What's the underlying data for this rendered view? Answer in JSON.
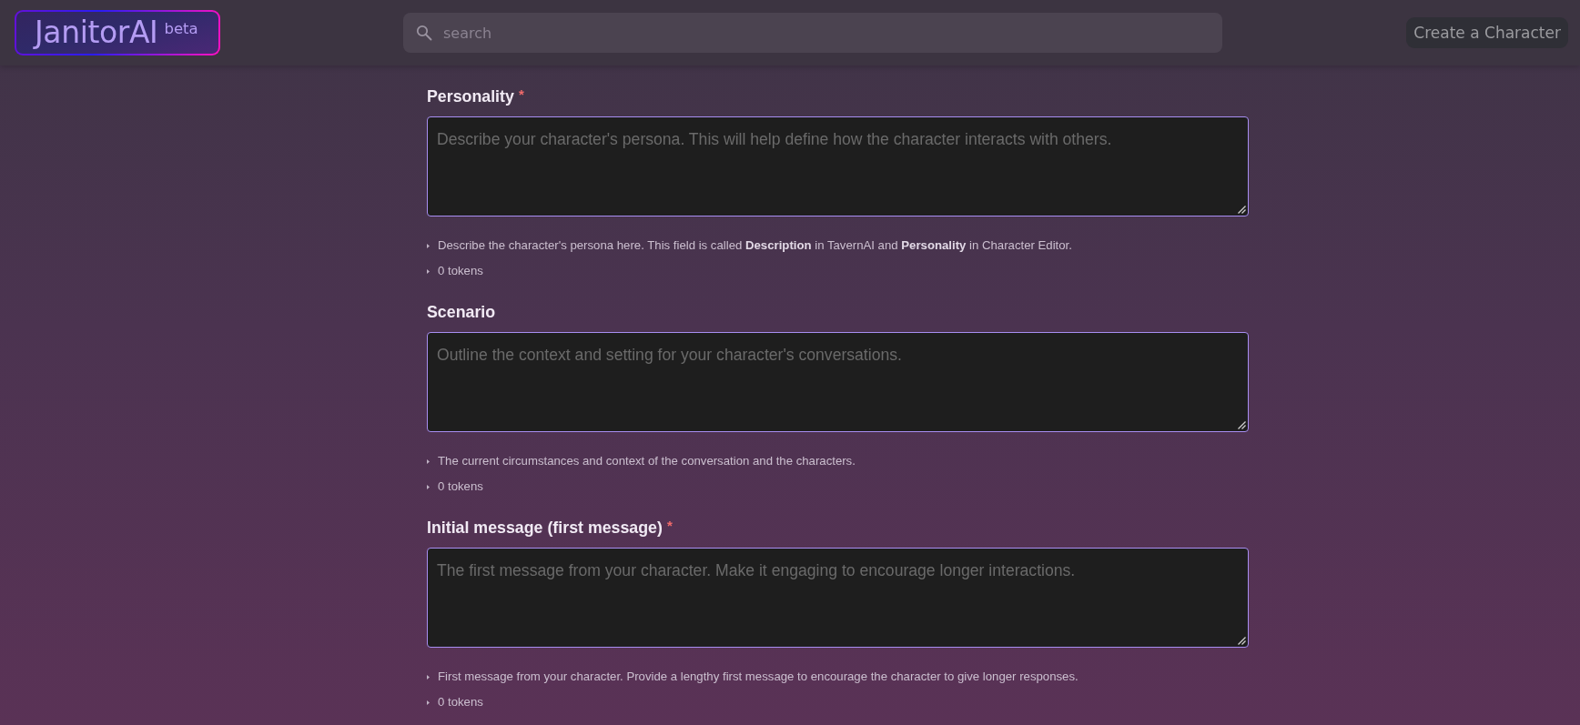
{
  "header": {
    "logo": {
      "name": "JanitorAI",
      "badge": "beta"
    },
    "search": {
      "placeholder": "search"
    },
    "create_button": "Create a Character"
  },
  "fields": [
    {
      "label": "Personality",
      "required_mark": "*",
      "placeholder": "Describe your character's persona. This will help define how the character interacts with others.",
      "help": "Describe the character's persona here. This field is called **Description** in TavernAI and **Personality** in Character Editor.",
      "tokens": "0 tokens"
    },
    {
      "label": "Scenario",
      "placeholder": "Outline the context and setting for your character's conversations.",
      "help": "The current circumstances and context of the conversation and the characters.",
      "tokens": "0 tokens"
    },
    {
      "label": "Initial message (first message)",
      "required_mark": "*",
      "placeholder": "The first message from your character. Make it engaging to encourage longer interactions.",
      "help": "First message from your character. Provide a lengthy first message to encourage the character to give longer responses.",
      "tokens": "0 tokens"
    }
  ]
}
